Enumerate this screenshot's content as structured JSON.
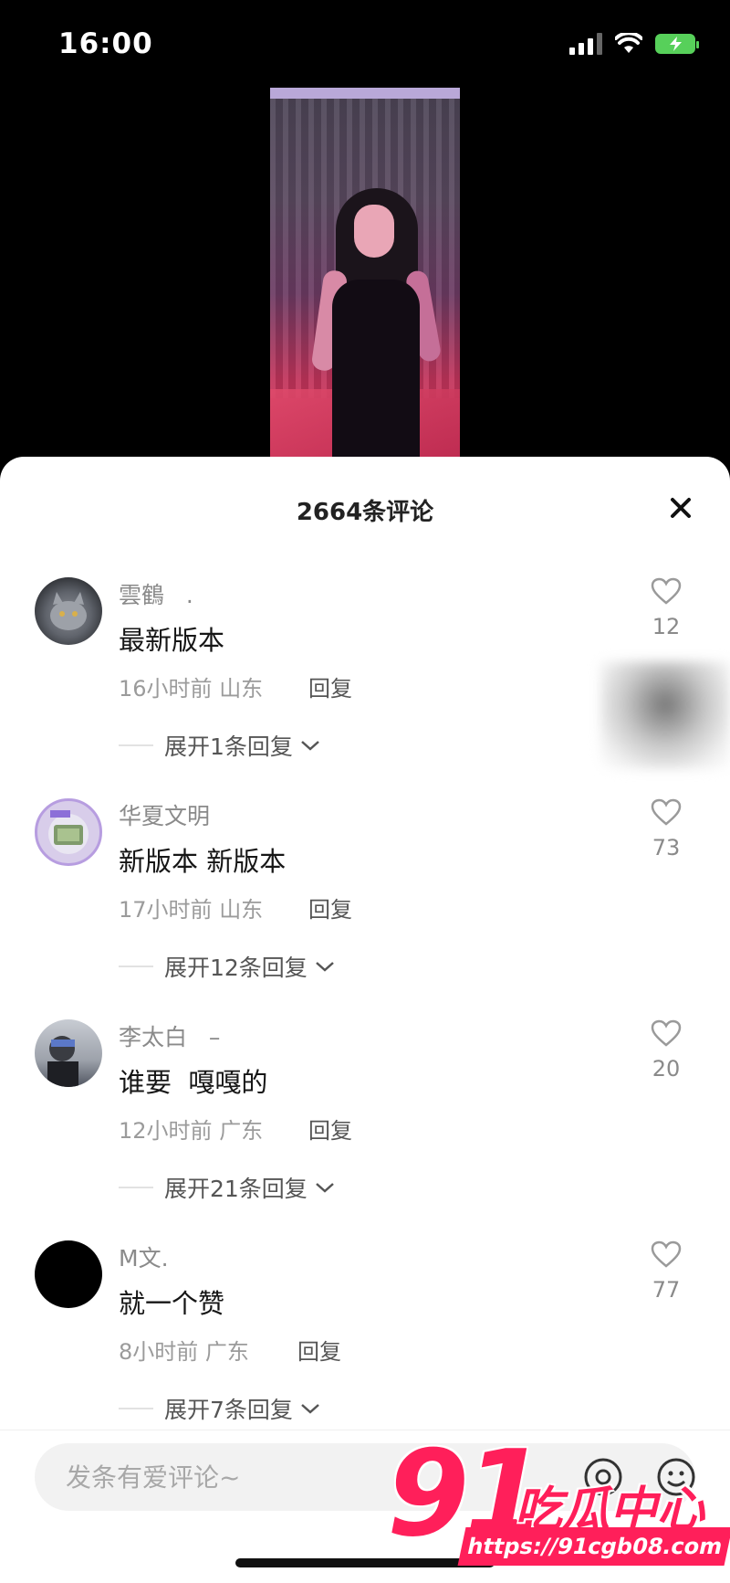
{
  "status_bar": {
    "time": "16:00"
  },
  "sheet": {
    "title": "2664条评论"
  },
  "comments": [
    {
      "user": "雲鶴",
      "user_suffix": ".",
      "text": "最新版本",
      "time": "16小时前",
      "location": "山东",
      "reply": "回复",
      "expand": "展开1条回复",
      "likes": "12"
    },
    {
      "user": "华夏文明",
      "user_suffix": "",
      "text": "新版本 新版本",
      "time": "17小时前",
      "location": "山东",
      "reply": "回复",
      "expand": "展开12条回复",
      "likes": "73"
    },
    {
      "user": "李太白",
      "user_suffix": "–",
      "text": "谁要  嘎嘎的",
      "time": "12小时前",
      "location": "广东",
      "reply": "回复",
      "expand": "展开21条回复",
      "likes": "20"
    },
    {
      "user": "M文.",
      "user_suffix": "",
      "text": "就一个赞",
      "time": "8小时前",
      "location": "广东",
      "reply": "回复",
      "expand": "展开7条回复",
      "likes": "77"
    }
  ],
  "input": {
    "placeholder": "发条有爱评论~"
  },
  "watermark": {
    "logo_number": "91",
    "logo_text": "吃瓜中心",
    "url": "https://91cgb08.com"
  },
  "colors": {
    "watermark": "#ff1f5a",
    "battery": "#57d05a"
  }
}
